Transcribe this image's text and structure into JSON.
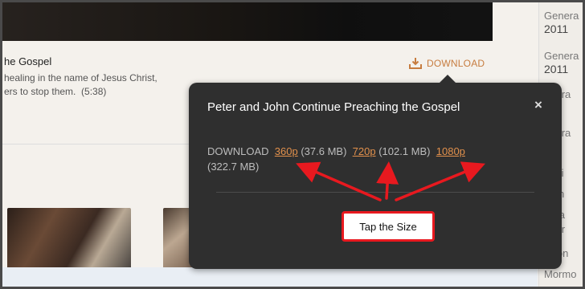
{
  "video": {
    "title": "he Gospel",
    "desc_line1": "healing in the name of Jesus Christ,",
    "desc_line2": "ers to stop them.",
    "duration": "(5:38)",
    "download_label": "DOWNLOAD"
  },
  "sidebar": {
    "items": [
      {
        "label": "Genera",
        "year": "2011"
      },
      {
        "label": "Genera",
        "year": "2011"
      },
      {
        "label": "enera",
        "year": "12"
      },
      {
        "label": "enera",
        "year": "12"
      },
      {
        "label": "mefi",
        "year": ""
      },
      {
        "label": "man",
        "year": ""
      },
      {
        "label": "erna",
        "year": ""
      },
      {
        "label": "nner",
        "year": ""
      },
      {
        "label": "ssion",
        "year": ""
      },
      {
        "label": "Mormo",
        "year": ""
      }
    ]
  },
  "popup": {
    "title": "Peter and John Continue Preaching the Gospel",
    "close": "×",
    "download_prefix": "DOWNLOAD",
    "options": [
      {
        "label": "360p",
        "size": "(37.6 MB)"
      },
      {
        "label": "720p",
        "size": "(102.1 MB)"
      },
      {
        "label": "1080p",
        "size": "(322.7 MB)"
      }
    ]
  },
  "callout": {
    "text": "Tap the Size"
  },
  "colors": {
    "accent": "#e1904c",
    "link": "#c77c3f",
    "popup_bg": "#2f2f2f",
    "callout_border": "#e8191f"
  },
  "icons": {
    "download": "download-icon",
    "close": "close-icon",
    "play": "play-icon"
  }
}
